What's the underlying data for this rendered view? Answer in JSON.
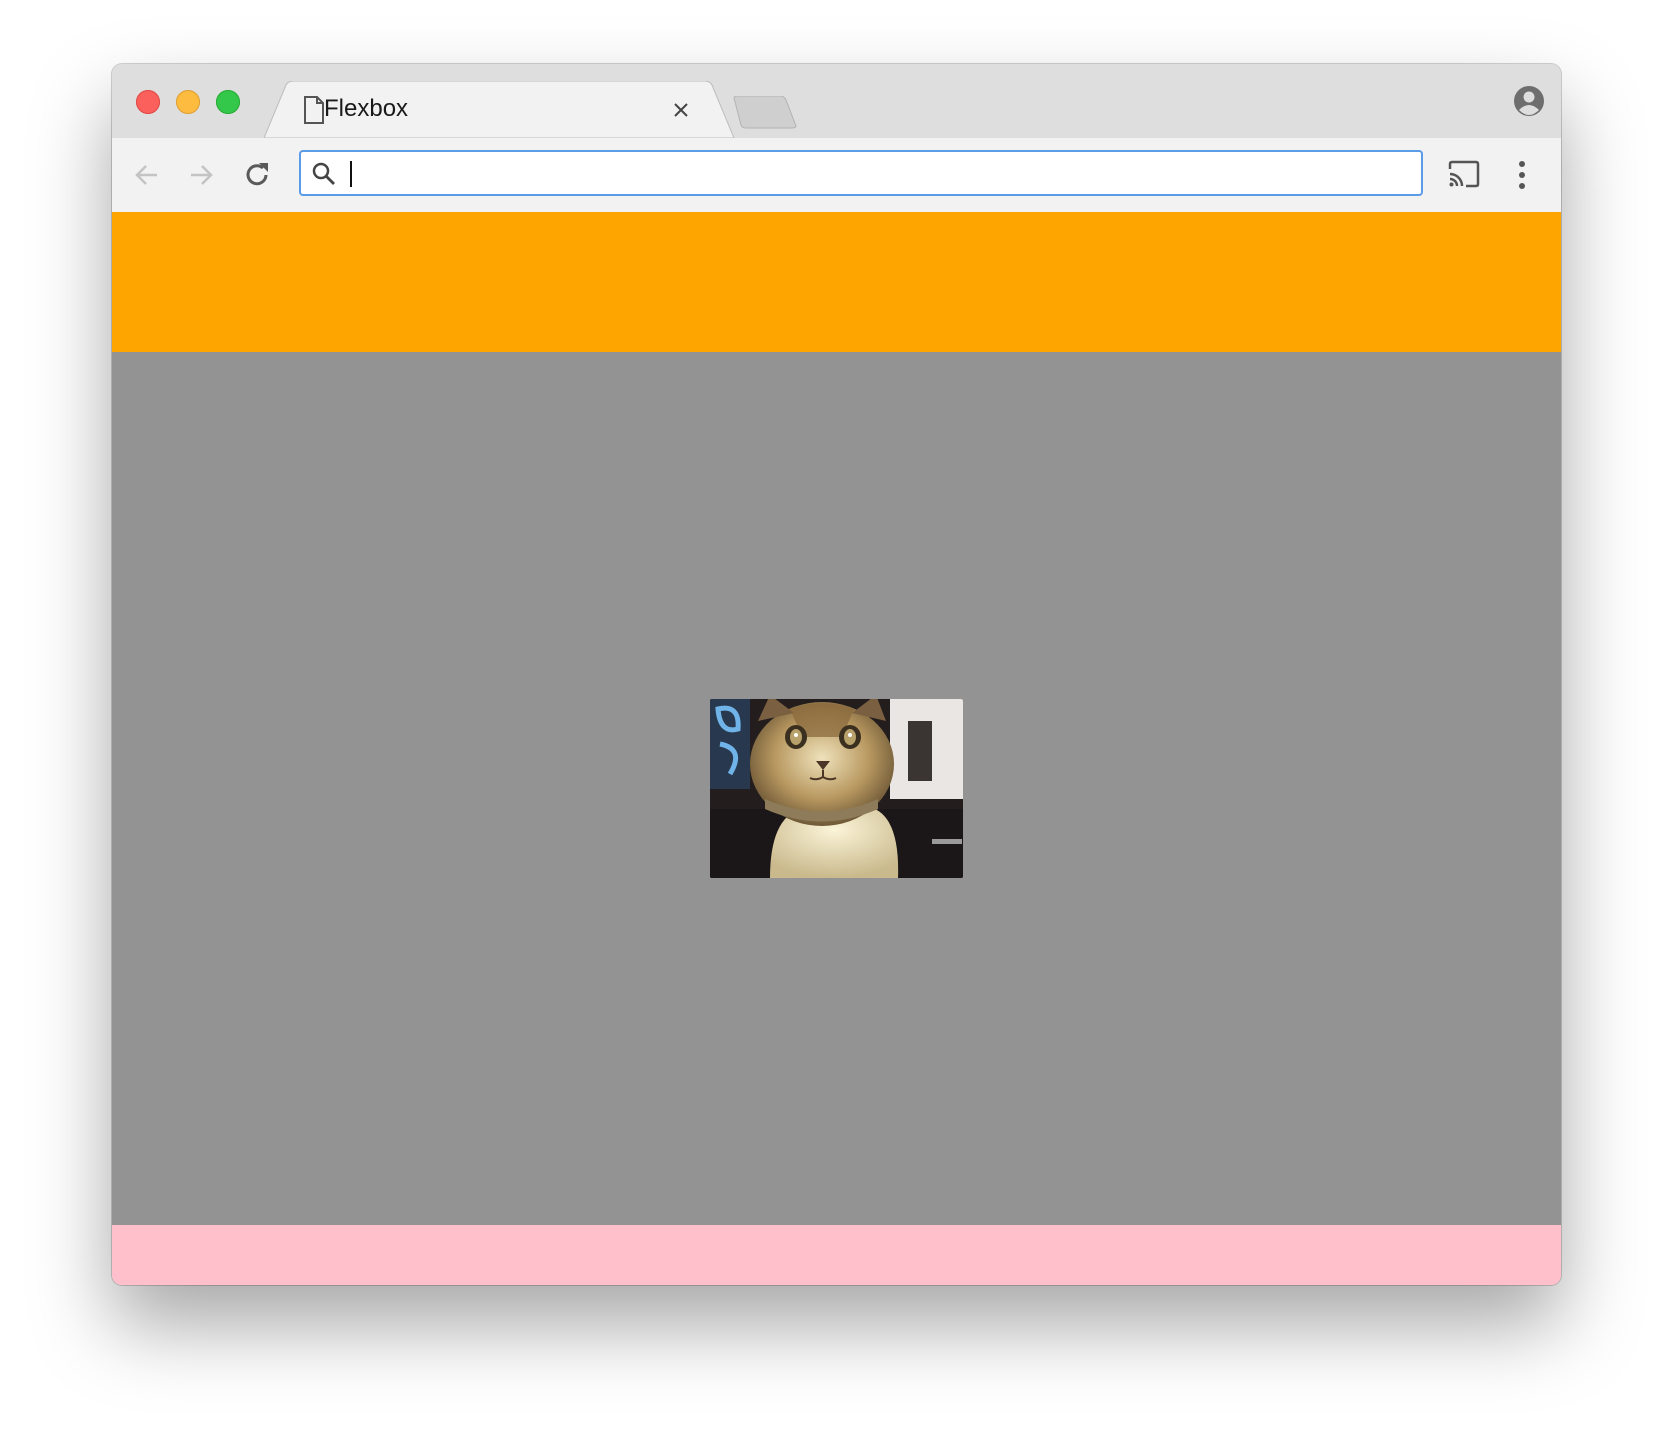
{
  "window": {
    "tab_title": "Flexbox",
    "icons": {
      "close_tab": "close-icon",
      "document": "document-icon",
      "profile": "profile-icon",
      "back": "back-arrow-icon",
      "forward": "forward-arrow-icon",
      "reload": "reload-icon",
      "search": "search-icon",
      "cast": "cast-icon",
      "menu": "more-vertical-icon"
    }
  },
  "omnibox": {
    "value": "",
    "placeholder": ""
  },
  "page": {
    "colors": {
      "header": "#ffa500",
      "main": "#939393",
      "footer": "#ffc0cb"
    },
    "image": {
      "subject": "cat-image"
    }
  }
}
